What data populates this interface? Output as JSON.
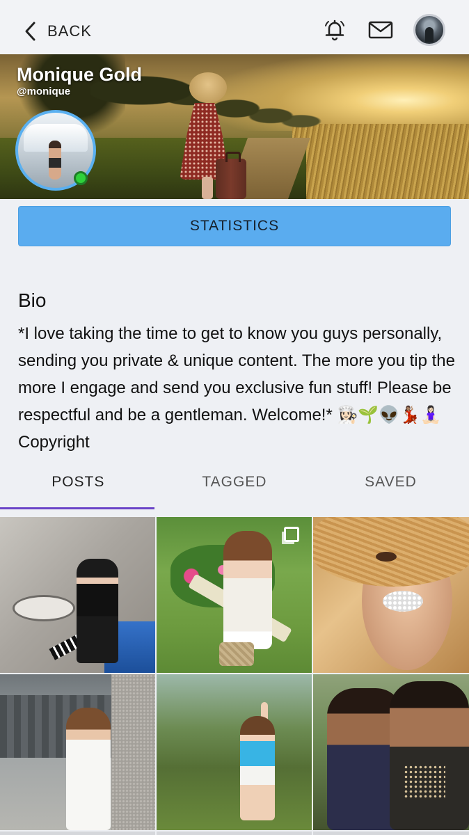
{
  "header": {
    "back_label": "BACK",
    "icons": [
      "bell-icon",
      "mail-icon"
    ]
  },
  "profile": {
    "name": "Monique Gold",
    "handle": "@monique",
    "online": true
  },
  "actions": {
    "statistics_label": "STATISTICS"
  },
  "bio": {
    "title": "Bio",
    "text": "*I love taking the time to get to know you guys personally, sending you private & unique content. The more you tip the more I engage and send you exclusive fun stuff! Please be respectful and be a gentleman. Welcome!* 👩🏻‍🍳🌱👽💃🏽🧘🏻‍♀️  Copyright"
  },
  "tabs": [
    {
      "label": "POSTS",
      "active": true
    },
    {
      "label": "TAGGED",
      "active": false
    },
    {
      "label": "SAVED",
      "active": false
    }
  ],
  "colors": {
    "accent_button": "#5aacef",
    "tab_indicator": "#6a44c7",
    "online_dot": "#2fd13b",
    "avatar_ring": "#5ab0f0"
  }
}
